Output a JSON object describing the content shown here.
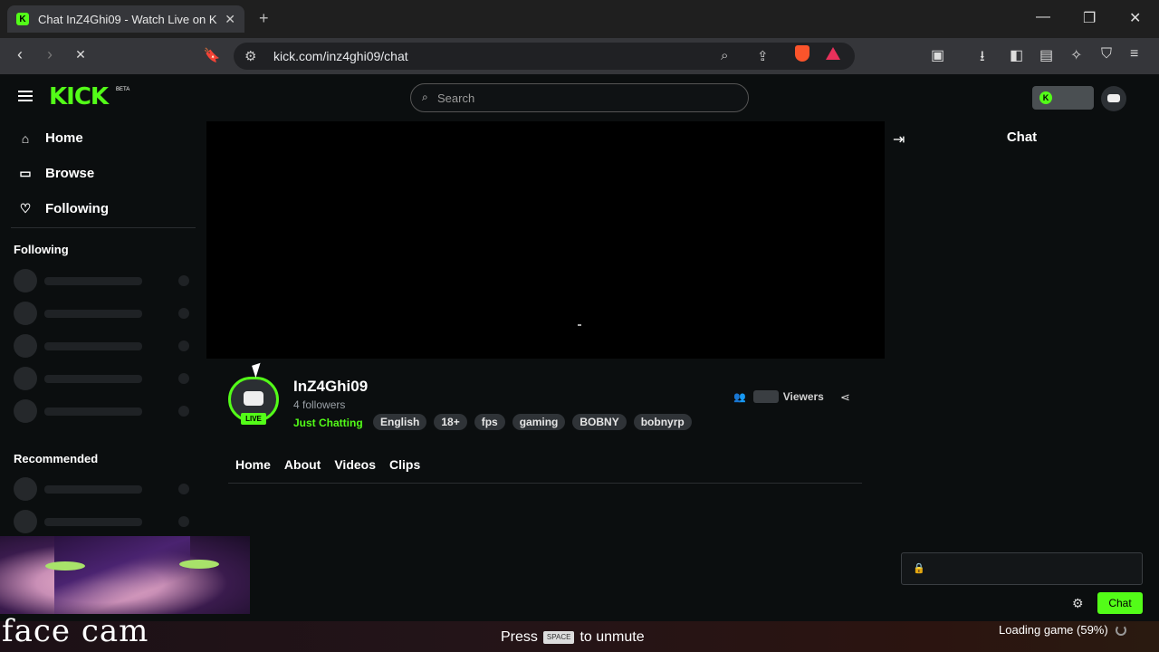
{
  "browser": {
    "tab_title": "Chat InZ4Ghi09 - Watch Live on K",
    "tab_close": "✕",
    "new_tab": "+",
    "url": "kick.com/inz4ghi09/chat",
    "win_min": "—",
    "win_max": "❐",
    "win_close": "✕"
  },
  "header": {
    "logo": "KICK",
    "beta": "BETA",
    "search_placeholder": "Search"
  },
  "sidebar": {
    "items": [
      {
        "label": "Home",
        "icon": "home-icon"
      },
      {
        "label": "Browse",
        "icon": "browse-icon"
      },
      {
        "label": "Following",
        "icon": "heart-icon"
      }
    ],
    "following_label": "Following",
    "recommended_label": "Recommended"
  },
  "channel": {
    "name": "InZ4Ghi09",
    "followers": "4 followers",
    "live_badge": "LIVE",
    "category": "Just Chatting",
    "tags": [
      "English",
      "18+",
      "fps",
      "gaming",
      "BOBNY",
      "bobnyrp"
    ],
    "viewers_label": "Viewers",
    "tabs": [
      "Home",
      "About",
      "Videos",
      "Clips"
    ]
  },
  "chat": {
    "title": "Chat",
    "send_label": "Chat"
  },
  "overlay": {
    "facecam_label": "face cam",
    "press": "Press",
    "key": "SPACE",
    "unmute": "to unmute",
    "loading": "Loading game (59%)"
  },
  "colors": {
    "accent": "#53fc18",
    "background": "#0b0e0f"
  }
}
